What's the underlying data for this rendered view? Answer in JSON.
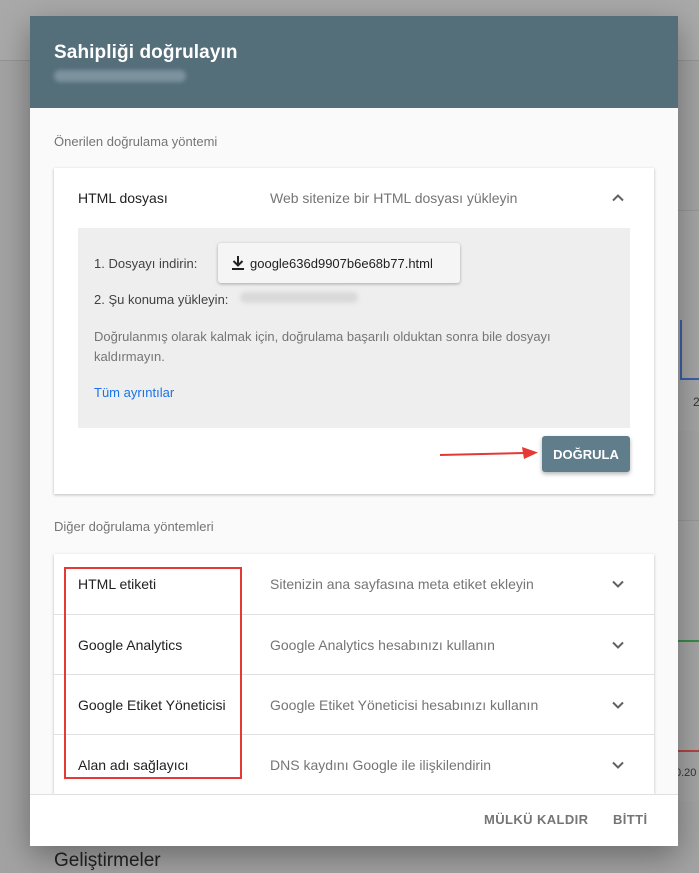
{
  "background": {
    "section_title": "Geliştirmeler",
    "chart_tick_1": "2",
    "chart_tick_2": "0.20"
  },
  "dialog": {
    "title": "Sahipliği doğrulayın",
    "recommended_label": "Önerilen doğrulama yöntemi",
    "recommended": {
      "name": "HTML dosyası",
      "description": "Web sitenize bir HTML dosyası yükleyin",
      "step1_label": "1. Dosyayı indirin:",
      "file_name": "google636d9907b6e68b77.html",
      "step2_label": "2. Şu konuma yükleyin:",
      "note": "Doğrulanmış olarak kalmak için, doğrulama başarılı olduktan sonra bile dosyayı kaldırmayın.",
      "details_link": "Tüm ayrıntılar",
      "verify_button": "DOĞRULA"
    },
    "other_label": "Diğer doğrulama yöntemleri",
    "other_methods": [
      {
        "name": "HTML etiketi",
        "description": "Sitenizin ana sayfasına meta etiket ekleyin"
      },
      {
        "name": "Google Analytics",
        "description": "Google Analytics hesabınızı kullanın"
      },
      {
        "name": "Google Etiket Yöneticisi",
        "description": "Google Etiket Yöneticisi hesabınızı kullanın"
      },
      {
        "name": "Alan adı sağlayıcı",
        "description": "DNS kaydını Google ile ilişkilendirin"
      }
    ],
    "footer": {
      "remove_button": "MÜLKÜ KALDIR",
      "done_button": "BİTTİ"
    }
  },
  "colors": {
    "header_bg": "#546e7a",
    "verify_bg": "#607d8b",
    "link": "#1a73e8",
    "highlight": "#e53935"
  },
  "icons": {
    "expanded": "chevron-up-icon",
    "collapsed": "chevron-down-icon",
    "download": "download-icon"
  }
}
